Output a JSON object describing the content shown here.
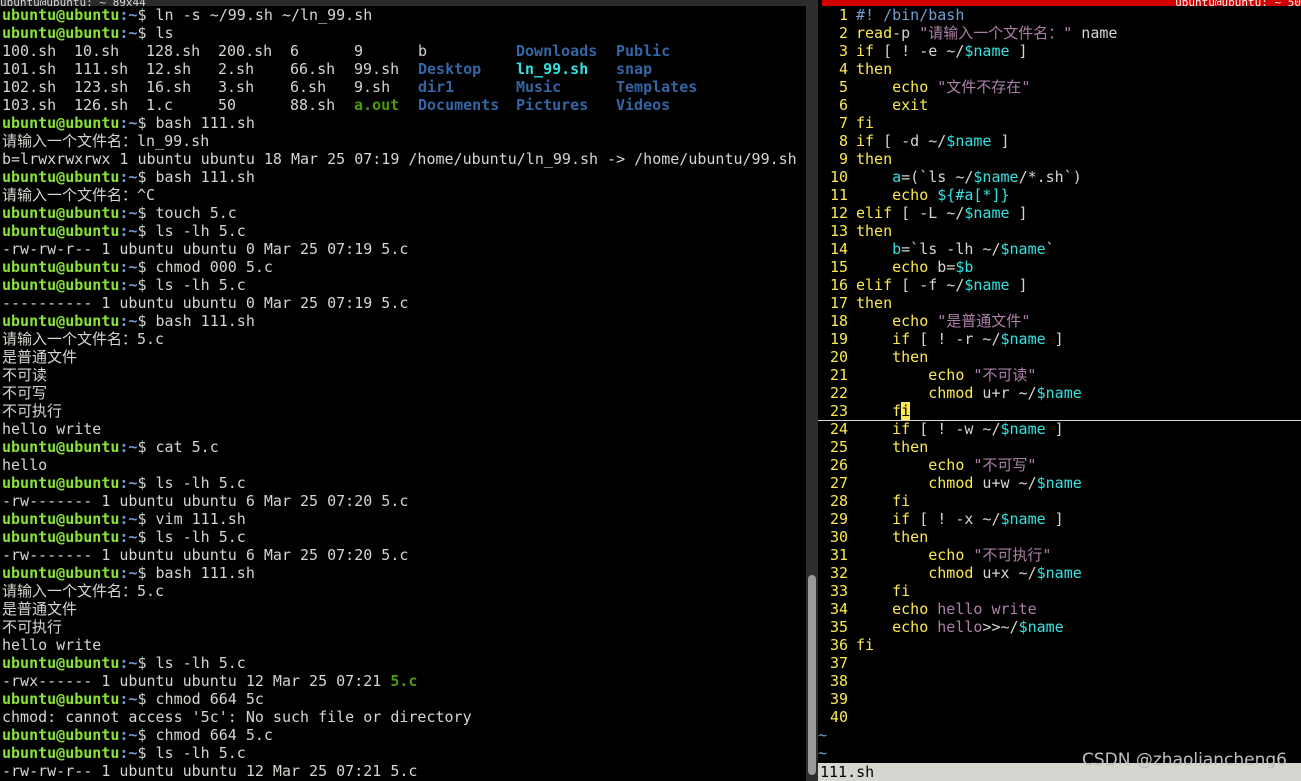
{
  "window": {
    "left_title": "ubuntu@ubuntu: ~ 89x44",
    "right_title": "ubuntu@ubuntu: ~ 50"
  },
  "left_terminal": {
    "prompt_user": "ubuntu@ubuntu",
    "prompt_path": ":~",
    "lines": [
      {
        "type": "cmd",
        "text": "$ ln -s ~/99.sh ~/ln_99.sh"
      },
      {
        "type": "cmd",
        "text": "$ ls"
      },
      {
        "type": "ls",
        "cells": [
          [
            "100.sh",
            ""
          ],
          [
            "10.sh",
            ""
          ],
          [
            "128.sh",
            ""
          ],
          [
            "200.sh",
            ""
          ],
          [
            "6",
            ""
          ],
          [
            "9",
            ""
          ],
          [
            "b",
            ""
          ],
          [
            "Downloads",
            "dir"
          ],
          [
            "Public",
            "dir"
          ]
        ]
      },
      {
        "type": "ls",
        "cells": [
          [
            "101.sh",
            ""
          ],
          [
            "111.sh",
            ""
          ],
          [
            "12.sh",
            ""
          ],
          [
            "2.sh",
            ""
          ],
          [
            "66.sh",
            ""
          ],
          [
            "99.sh",
            ""
          ],
          [
            "Desktop",
            "dir"
          ],
          [
            "ln_99.sh",
            "lnk"
          ],
          [
            "snap",
            "dir"
          ]
        ]
      },
      {
        "type": "ls",
        "cells": [
          [
            "102.sh",
            ""
          ],
          [
            "123.sh",
            ""
          ],
          [
            "16.sh",
            ""
          ],
          [
            "3.sh",
            ""
          ],
          [
            "6.sh",
            ""
          ],
          [
            "9.sh",
            ""
          ],
          [
            "dir1",
            "dir"
          ],
          [
            "Music",
            "dir"
          ],
          [
            "Templates",
            "dir"
          ]
        ]
      },
      {
        "type": "ls",
        "cells": [
          [
            "103.sh",
            ""
          ],
          [
            "126.sh",
            ""
          ],
          [
            "1.c",
            ""
          ],
          [
            "50",
            ""
          ],
          [
            "88.sh",
            ""
          ],
          [
            "a.out",
            "exe"
          ],
          [
            "Documents",
            "dir"
          ],
          [
            "Pictures",
            "dir"
          ],
          [
            "Videos",
            "dir"
          ]
        ]
      },
      {
        "type": "cmd",
        "text": "$ bash 111.sh"
      },
      {
        "type": "out",
        "text": "请输入一个文件名：ln_99.sh"
      },
      {
        "type": "out",
        "text": "b=lrwxrwxrwx 1 ubuntu ubuntu 18 Mar 25 07:19 /home/ubuntu/ln_99.sh -> /home/ubuntu/99.sh"
      },
      {
        "type": "cmd",
        "text": "$ bash 111.sh"
      },
      {
        "type": "out",
        "text": "请输入一个文件名：^C"
      },
      {
        "type": "cmd",
        "text": "$ touch 5.c"
      },
      {
        "type": "cmd",
        "text": "$ ls -lh 5.c"
      },
      {
        "type": "out",
        "text": "-rw-rw-r-- 1 ubuntu ubuntu 0 Mar 25 07:19 5.c"
      },
      {
        "type": "cmd",
        "text": "$ chmod 000 5.c"
      },
      {
        "type": "cmd",
        "text": "$ ls -lh 5.c"
      },
      {
        "type": "out",
        "text": "---------- 1 ubuntu ubuntu 0 Mar 25 07:19 5.c"
      },
      {
        "type": "cmd",
        "text": "$ bash 111.sh"
      },
      {
        "type": "out",
        "text": "请输入一个文件名：5.c"
      },
      {
        "type": "out",
        "text": "是普通文件"
      },
      {
        "type": "out",
        "text": "不可读"
      },
      {
        "type": "out",
        "text": "不可写"
      },
      {
        "type": "out",
        "text": "不可执行"
      },
      {
        "type": "out",
        "text": "hello write"
      },
      {
        "type": "cmd",
        "text": "$ cat 5.c"
      },
      {
        "type": "out",
        "text": "hello"
      },
      {
        "type": "cmd",
        "text": "$ ls -lh 5.c"
      },
      {
        "type": "out",
        "text": "-rw------- 1 ubuntu ubuntu 6 Mar 25 07:20 5.c"
      },
      {
        "type": "cmd",
        "text": "$ vim 111.sh"
      },
      {
        "type": "cmd",
        "text": "$ ls -lh 5.c"
      },
      {
        "type": "out",
        "text": "-rw------- 1 ubuntu ubuntu 6 Mar 25 07:20 5.c"
      },
      {
        "type": "cmd",
        "text": "$ bash 111.sh"
      },
      {
        "type": "out",
        "text": "请输入一个文件名：5.c"
      },
      {
        "type": "out",
        "text": "是普通文件"
      },
      {
        "type": "out",
        "text": "不可执行"
      },
      {
        "type": "out",
        "text": "hello write"
      },
      {
        "type": "cmd",
        "text": "$ ls -lh 5.c"
      },
      {
        "type": "outg",
        "text": "-rwx------ 1 ubuntu ubuntu 12 Mar 25 07:21 ",
        "green": "5.c"
      },
      {
        "type": "cmd",
        "text": "$ chmod 664 5c"
      },
      {
        "type": "out",
        "text": "chmod: cannot access '5c': No such file or directory"
      },
      {
        "type": "cmd",
        "text": "$ chmod 664 5.c"
      },
      {
        "type": "cmd",
        "text": "$ ls -lh 5.c"
      },
      {
        "type": "out",
        "text": "-rw-rw-r-- 1 ubuntu ubuntu 12 Mar 25 07:21 5.c"
      }
    ]
  },
  "editor": {
    "filename": "111.sh",
    "lines": [
      [
        [
          "cmt",
          "#! /bin/bash"
        ]
      ],
      [
        [
          "kw",
          "read"
        ],
        [
          "",
          "-p "
        ],
        [
          "str",
          "\"请输入一个文件名：\""
        ],
        [
          "",
          " name"
        ]
      ],
      [
        [
          "kw",
          "if"
        ],
        [
          "",
          " [ ! -e ~/"
        ],
        [
          "var",
          "$name"
        ],
        [
          "",
          " ]"
        ]
      ],
      [
        [
          "kw",
          "then"
        ]
      ],
      [
        [
          "",
          "    "
        ],
        [
          "kw",
          "echo"
        ],
        [
          "",
          " "
        ],
        [
          "str",
          "\"文件不存在\""
        ]
      ],
      [
        [
          "",
          "    "
        ],
        [
          "kw",
          "exit"
        ]
      ],
      [
        [
          "kw",
          "fi"
        ]
      ],
      [
        [
          "kw",
          "if"
        ],
        [
          "",
          " [ -d ~/"
        ],
        [
          "var",
          "$name"
        ],
        [
          "",
          " ]"
        ]
      ],
      [
        [
          "kw",
          "then"
        ]
      ],
      [
        [
          "",
          "    "
        ],
        [
          "var",
          "a"
        ],
        [
          "",
          "=(`ls ~/"
        ],
        [
          "var",
          "$name"
        ],
        [
          "",
          "/*.sh`)"
        ]
      ],
      [
        [
          "",
          "    "
        ],
        [
          "kw",
          "echo"
        ],
        [
          "",
          " "
        ],
        [
          "var",
          "${#a[*]}"
        ]
      ],
      [
        [
          "kw",
          "elif"
        ],
        [
          "",
          " [ -L ~/"
        ],
        [
          "var",
          "$name"
        ],
        [
          "",
          " ]"
        ]
      ],
      [
        [
          "kw",
          "then"
        ]
      ],
      [
        [
          "",
          "    "
        ],
        [
          "var",
          "b"
        ],
        [
          "",
          "=`ls -lh ~/"
        ],
        [
          "var",
          "$name"
        ],
        [
          "",
          "`"
        ]
      ],
      [
        [
          "",
          "    "
        ],
        [
          "kw",
          "echo"
        ],
        [
          "",
          " b="
        ],
        [
          "var",
          "$b"
        ]
      ],
      [
        [
          "kw",
          "elif"
        ],
        [
          "",
          " [ -f ~/"
        ],
        [
          "var",
          "$name"
        ],
        [
          "",
          " ]"
        ]
      ],
      [
        [
          "kw",
          "then"
        ]
      ],
      [
        [
          "",
          "    "
        ],
        [
          "kw",
          "echo"
        ],
        [
          "",
          " "
        ],
        [
          "str",
          "\"是普通文件\""
        ]
      ],
      [
        [
          "",
          "    "
        ],
        [
          "kw",
          "if"
        ],
        [
          "",
          " [ ! -r ~/"
        ],
        [
          "var",
          "$name"
        ],
        [
          "",
          " ]"
        ]
      ],
      [
        [
          "",
          "    "
        ],
        [
          "kw",
          "then"
        ]
      ],
      [
        [
          "",
          "        "
        ],
        [
          "kw",
          "echo"
        ],
        [
          "",
          " "
        ],
        [
          "str",
          "\"不可读\""
        ]
      ],
      [
        [
          "",
          "        "
        ],
        [
          "kw",
          "chmod"
        ],
        [
          "",
          " u+r ~/"
        ],
        [
          "var",
          "$name"
        ]
      ],
      [
        [
          "",
          "    "
        ],
        [
          "kw",
          "f"
        ],
        [
          "cursor",
          "i"
        ]
      ],
      [
        [
          "",
          "    "
        ],
        [
          "kw",
          "if"
        ],
        [
          "",
          " [ ! -w ~/"
        ],
        [
          "var",
          "$name"
        ],
        [
          "",
          " ]"
        ]
      ],
      [
        [
          "",
          "    "
        ],
        [
          "kw",
          "then"
        ]
      ],
      [
        [
          "",
          "        "
        ],
        [
          "kw",
          "echo"
        ],
        [
          "",
          " "
        ],
        [
          "str",
          "\"不可写\""
        ]
      ],
      [
        [
          "",
          "        "
        ],
        [
          "kw",
          "chmod"
        ],
        [
          "",
          " u+w ~/"
        ],
        [
          "var",
          "$name"
        ]
      ],
      [
        [
          "",
          "    "
        ],
        [
          "kw",
          "fi"
        ]
      ],
      [
        [
          "",
          "    "
        ],
        [
          "kw",
          "if"
        ],
        [
          "",
          " [ ! -x ~/"
        ],
        [
          "var",
          "$name"
        ],
        [
          "",
          " ]"
        ]
      ],
      [
        [
          "",
          "    "
        ],
        [
          "kw",
          "then"
        ]
      ],
      [
        [
          "",
          "        "
        ],
        [
          "kw",
          "echo"
        ],
        [
          "",
          " "
        ],
        [
          "str",
          "\"不可执行\""
        ]
      ],
      [
        [
          "",
          "        "
        ],
        [
          "kw",
          "chmod"
        ],
        [
          "",
          " u+x ~/"
        ],
        [
          "var",
          "$name"
        ]
      ],
      [
        [
          "",
          "    "
        ],
        [
          "kw",
          "fi"
        ]
      ],
      [
        [
          "",
          "    "
        ],
        [
          "kw",
          "echo"
        ],
        [
          "",
          " "
        ],
        [
          "str",
          "hello write"
        ]
      ],
      [
        [
          "",
          "    "
        ],
        [
          "kw",
          "echo"
        ],
        [
          "",
          " "
        ],
        [
          "str",
          "hello"
        ],
        [
          "",
          ">>~/"
        ],
        [
          "var",
          "$name"
        ]
      ],
      [
        [
          "kw",
          "fi"
        ]
      ],
      [],
      [],
      [],
      []
    ],
    "tilde_lines": 2
  },
  "watermark": "CSDN @zhaoliancheng6"
}
